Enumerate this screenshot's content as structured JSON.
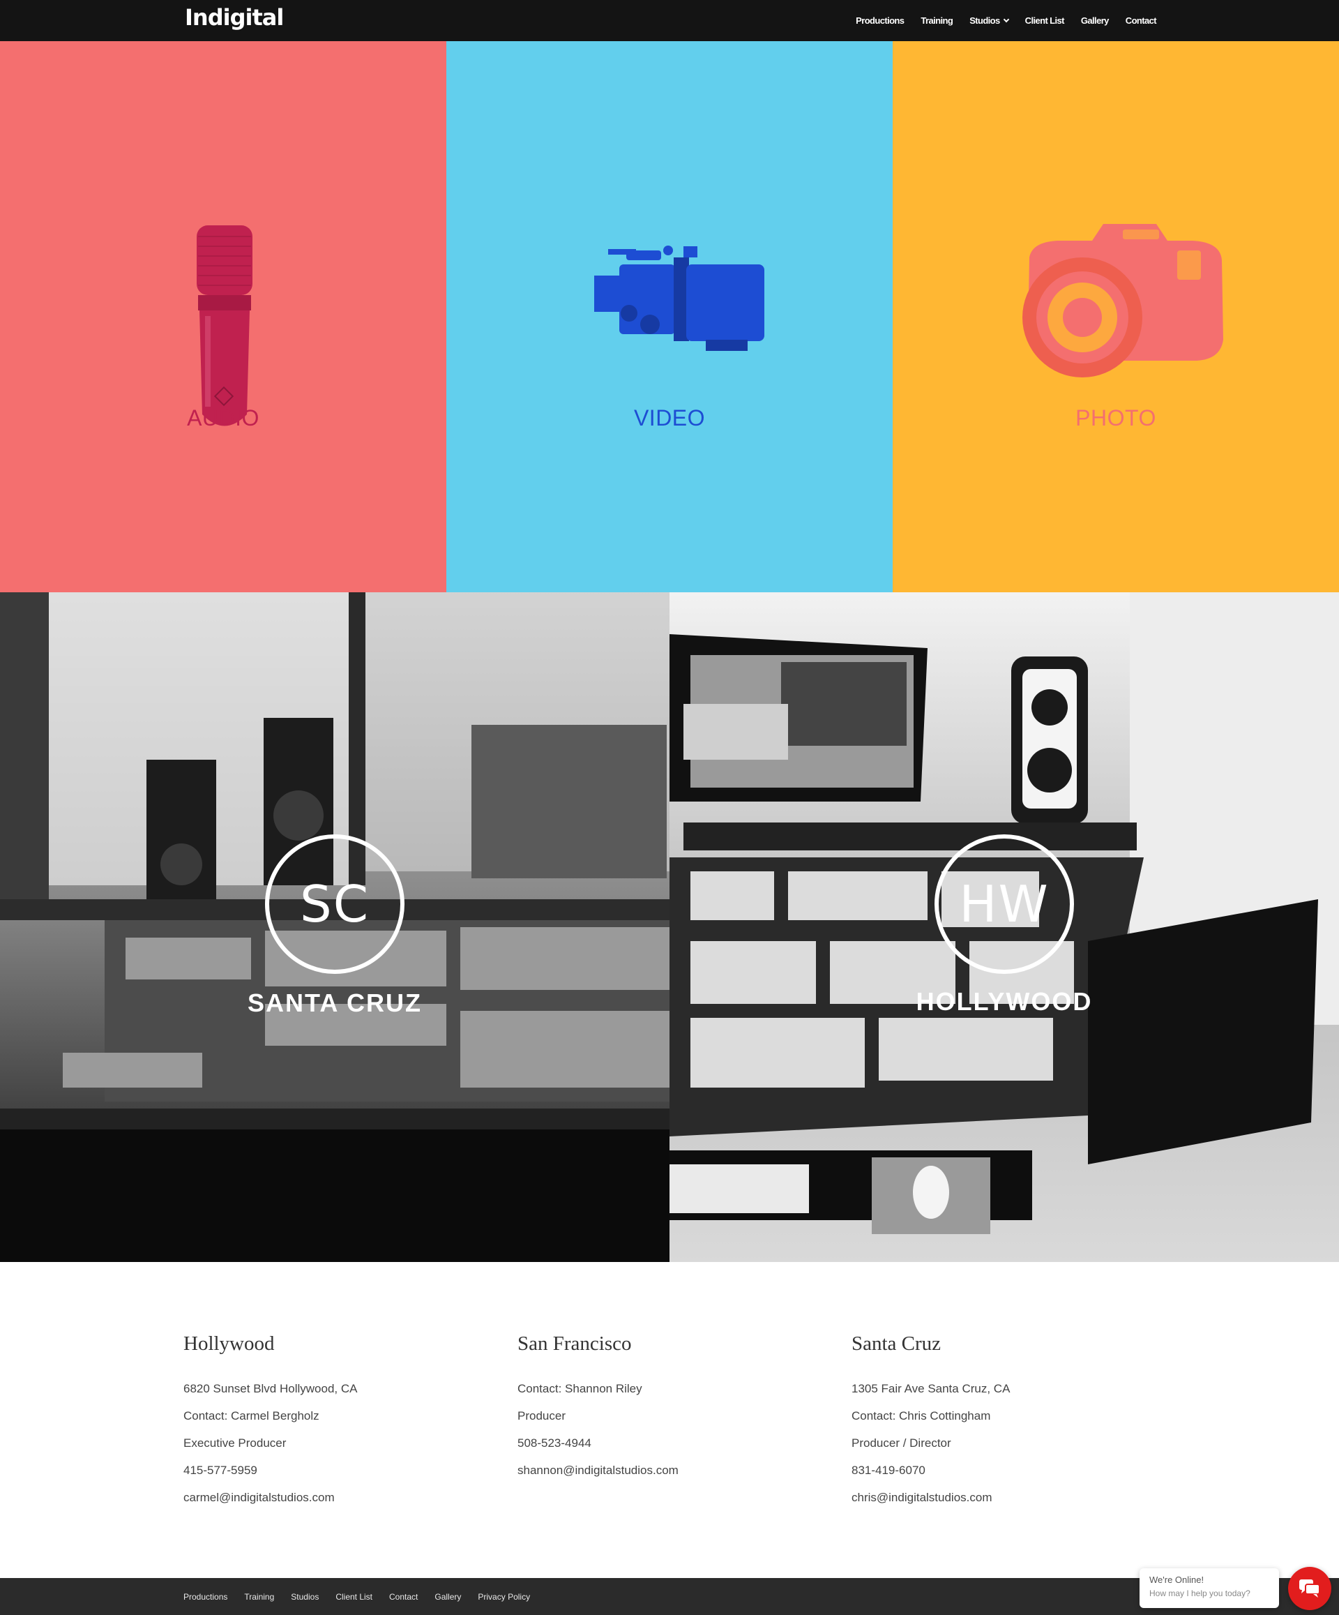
{
  "header": {
    "logo": "Indigital",
    "nav": [
      {
        "label": "Productions"
      },
      {
        "label": "Training"
      },
      {
        "label": "Studios"
      },
      {
        "label": "Client List"
      },
      {
        "label": "Gallery"
      },
      {
        "label": "Contact"
      }
    ]
  },
  "services": [
    {
      "label": "AUDIO",
      "icon": "microphone-icon",
      "bg_color": "#f46f6f",
      "fg_color": "#c0214f"
    },
    {
      "label": "VIDEO",
      "icon": "video-camera-icon",
      "bg_color": "#62cfed",
      "fg_color": "#1d4dd3"
    },
    {
      "label": "PHOTO",
      "icon": "photo-camera-icon",
      "bg_color": "#ffb733",
      "fg_color": "#f46f6f"
    }
  ],
  "studios": [
    {
      "badge": "SC",
      "name": "SANTA CRUZ"
    },
    {
      "badge": "HW",
      "name": "HOLLYWOOD"
    }
  ],
  "contacts": [
    {
      "city": "Hollywood",
      "lines": [
        "6820 Sunset Blvd Hollywood, CA",
        "Contact: Carmel Bergholz",
        "Executive Producer",
        "415-577-5959",
        "carmel@indigitalstudios.com"
      ]
    },
    {
      "city": "San Francisco",
      "lines": [
        "Contact: Shannon Riley",
        "Producer",
        "508-523-4944",
        "shannon@indigitalstudios.com"
      ]
    },
    {
      "city": "Santa Cruz",
      "lines": [
        "1305 Fair Ave Santa Cruz, CA",
        "Contact: Chris Cottingham",
        "Producer / Director",
        "831-419-6070",
        "chris@indigitalstudios.com"
      ]
    }
  ],
  "footer": {
    "links": [
      "Productions",
      "Training",
      "Studios",
      "Client List",
      "Contact",
      "Gallery",
      "Privacy Policy"
    ]
  },
  "chat": {
    "title": "We're Online!",
    "subtitle": "How may I help you today?"
  }
}
